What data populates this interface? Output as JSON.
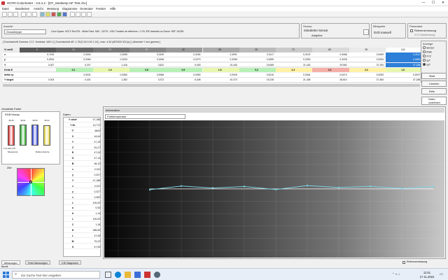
{
  "window": {
    "title": "HCFR-Colorimeter - 3.5.4.2 - [DT_Seekemp HF Test.chc]",
    "minimize": "—",
    "maximize": "☐",
    "close": "✕"
  },
  "menu": [
    "Datei",
    "Bearbeiten",
    "Ansicht",
    "Messung",
    "Diagramme",
    "Generator",
    "Fenster",
    "Hilfe"
  ],
  "ansicht": {
    "label": "Ansicht",
    "value": "Graustreppe",
    "info": "Color Space: HDTV Rec709 - White Point: D65 - CIE76 : 1931 Transfer de référence = 2.20, IRE dessinés ou Scene. REF 16/235"
  },
  "sensor": {
    "label": "Sensor",
    "line1": "Simulierter Sensor",
    "line2": "Adaptive"
  },
  "bildquelle": {
    "label": "Bildquelle",
    "value": "DVD manuell"
  },
  "parameter": {
    "label": "Parameter",
    "opt1": "Referenzmessung",
    "opt2": "XYZ Abstimmung"
  },
  "stats": "[ Durchschnitt Gamma: 2.17, Kontrast: 449:1 ] [ Durchschnitt dE: 1.78 [0.16 0.00 1.14] ; max: 4.30 (dE2000 ICtCp) ] [ Absolute Y w/o gamma ]",
  "grid": {
    "header_label": "% weiß",
    "cols": [
      "0",
      "10",
      "20",
      "30",
      "40",
      "50",
      "60",
      "70",
      "80",
      "90",
      "100"
    ],
    "rows": [
      {
        "label": "x",
        "values": [
          "0,7153",
          "0,3094",
          "0,3056",
          "0,3190",
          "0,3184",
          "0,3091",
          "0,3117",
          "0,3123",
          "0,3068",
          "0,3069",
          "0,3112"
        ]
      },
      {
        "label": "y",
        "values": [
          "0,2634",
          "0,3284",
          "0,3234",
          "0,3246",
          "0,3270",
          "0,3256",
          "0,3289",
          "0,3253",
          "0,3228",
          "0,3254",
          "0,3289"
        ]
      },
      {
        "label": "Y",
        "values": [
          "0,307",
          "0,207",
          "1,416",
          "3,622",
          "9,453",
          "10,446",
          "15,569",
          "21,418",
          "29,962",
          "37,290",
          "47,188"
        ]
      },
      {
        "label": "Delta E",
        "values": [
          "",
          "0,1",
          "1,0",
          "0,8",
          "0,9",
          "1,8",
          "0,3",
          "2,3",
          "4,3",
          "2,4",
          "1,9"
        ]
      },
      {
        "label": "delta xy",
        "values": [
          "",
          "0,0031",
          "0,0060",
          "0,0066",
          "0,0050",
          "0,0049",
          "0,0010",
          "0,0044",
          "0,0074",
          "0,0053",
          "0,0027"
        ]
      },
      {
        "label": "Y target",
        "values": [
          "0,003",
          "0,331",
          "1,382",
          "3,372",
          "6,348",
          "10,373",
          "15,235",
          "21,438",
          "28,810",
          "37,384",
          "47,188"
        ]
      }
    ]
  },
  "anzeige": {
    "label": "Anzeige",
    "options": [
      "Sensor",
      "RGB",
      "XYZ",
      "xyY",
      "xyY"
    ],
    "start": "Start",
    "loeschen": "Löschen",
    "refs": "Refs",
    "daten": "Daten",
    "undefined": "undefiniert"
  },
  "left_panel": {
    "title": "Gewählte Farbe",
    "rgb_label": "RGB Niveau",
    "bars": [
      {
        "label": "96,25",
        "color": "#d21f1f"
      },
      {
        "label": "99,91",
        "color": "#1da31d"
      },
      {
        "label": "99,55",
        "color": "#2233cc"
      },
      {
        "label": "96,54",
        "color": "#e2d23a"
      }
    ],
    "bar_captions": [
      "171,193,178",
      "Messwerte",
      "Referenzwerte"
    ],
    "ziel_label": "Ziel",
    "daten_label": "Daten",
    "data_rows": [
      {
        "k": "Y cd/m²",
        "v": "47,188"
      },
      {
        "k": "Y ftL",
        "v": "13,772"
      },
      {
        "k": "T°",
        "v": "6603"
      },
      {
        "k": "X",
        "v": "44,64"
      },
      {
        "k": "Y",
        "v": "47,19"
      },
      {
        "k": "Z",
        "v": "51,27"
      },
      {
        "k": "R",
        "v": "47,03"
      },
      {
        "k": "G",
        "v": "47,14"
      },
      {
        "k": "B",
        "v": "48,12"
      },
      {
        "k": "x",
        "v": "0,311"
      },
      {
        "k": "y",
        "v": "0,327"
      },
      {
        "k": "Y",
        "v": "47,188"
      },
      {
        "k": "x",
        "v": "0,311"
      },
      {
        "k": "y",
        "v": "0,327"
      },
      {
        "k": "z",
        "v": "0,362"
      },
      {
        "k": "L",
        "v": "100,00"
      },
      {
        "k": "a",
        "v": "0,53"
      },
      {
        "k": "b",
        "v": "1,14"
      },
      {
        "k": "L",
        "v": "100,00"
      },
      {
        "k": "C",
        "v": "1,16"
      },
      {
        "k": "H",
        "v": "285,50"
      },
      {
        "k": "L",
        "v": "47,05"
      },
      {
        "k": "M",
        "v": "79,22"
      },
      {
        "k": "S",
        "v": "47,90"
      }
    ]
  },
  "information": {
    "label": "Information",
    "dropdown": "Farbtemperatur"
  },
  "chart_data": {
    "type": "line",
    "x": [
      10,
      20,
      30,
      40,
      50,
      60,
      70,
      80,
      90,
      100
    ],
    "series": [
      {
        "values": [
          6470,
          6620,
          6540,
          6600,
          6480,
          6640,
          6560,
          6610,
          6520,
          6603
        ]
      }
    ],
    "ylim": [
      4000,
      9000
    ],
    "xlabel": "",
    "ylabel": "",
    "grid": true,
    "line_color": "#7fd3e6",
    "ref_line_color": "#ffffff"
  },
  "bottom_tabs": [
    "Messungen",
    "Freie Messungen",
    "CIE Diagramm"
  ],
  "status": {
    "left": "Bereit",
    "ref": "Referenzmessung"
  },
  "taskbar": {
    "search_placeholder": "Zur Suche Text hier eingeben",
    "time": "11:51",
    "date": "17.11.2022"
  }
}
